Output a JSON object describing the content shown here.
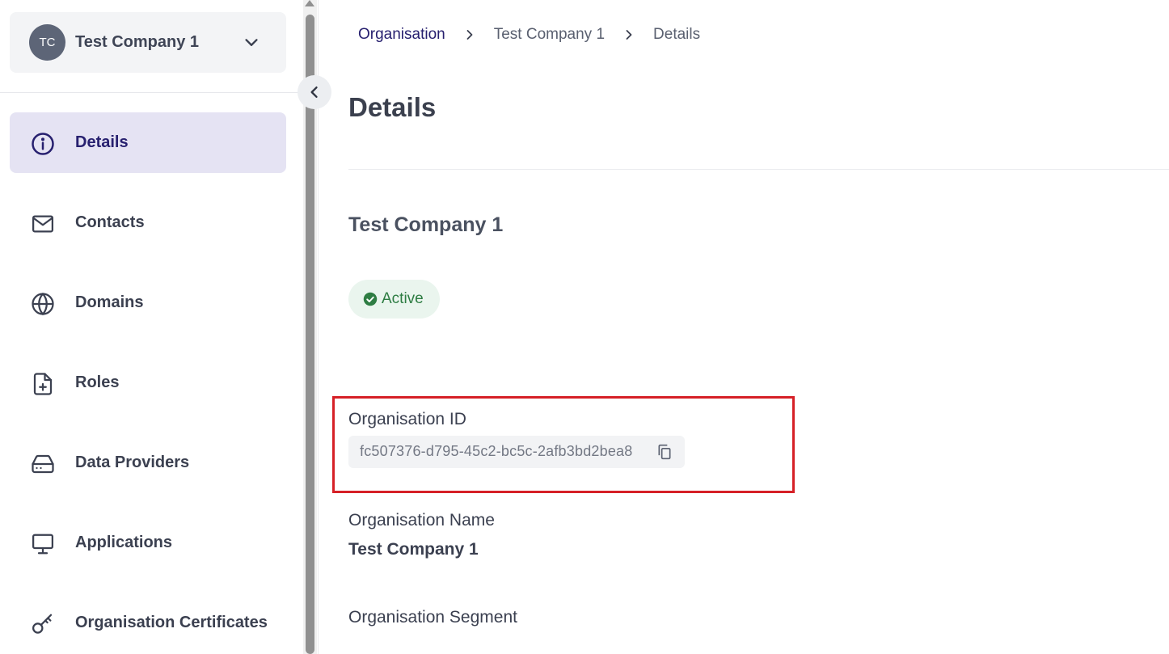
{
  "org_switcher": {
    "initials": "TC",
    "name": "Test Company 1"
  },
  "sidebar": {
    "items": [
      {
        "label": "Details",
        "icon": "info-icon",
        "active": true
      },
      {
        "label": "Contacts",
        "icon": "mail-icon",
        "active": false
      },
      {
        "label": "Domains",
        "icon": "globe-icon",
        "active": false
      },
      {
        "label": "Roles",
        "icon": "file-plus-icon",
        "active": false
      },
      {
        "label": "Data Providers",
        "icon": "hard-drive-icon",
        "active": false
      },
      {
        "label": "Applications",
        "icon": "monitor-icon",
        "active": false
      },
      {
        "label": "Organisation Certificates",
        "icon": "key-icon",
        "active": false
      }
    ]
  },
  "breadcrumb": {
    "items": [
      "Organisation",
      "Test Company 1",
      "Details"
    ]
  },
  "page": {
    "title": "Details",
    "company_name": "Test Company 1",
    "status": "Active"
  },
  "fields": {
    "org_id_label": "Organisation ID",
    "org_id_value": "fc507376-d795-45c2-bc5c-2afb3bd2bea8",
    "org_name_label": "Organisation Name",
    "org_name_value": "Test Company 1",
    "org_segment_label": "Organisation Segment"
  },
  "colors": {
    "accent": "#27206f",
    "active_nav_bg": "#e5e3f3",
    "status_green": "#2e7d43",
    "highlight_red": "#d62027"
  }
}
